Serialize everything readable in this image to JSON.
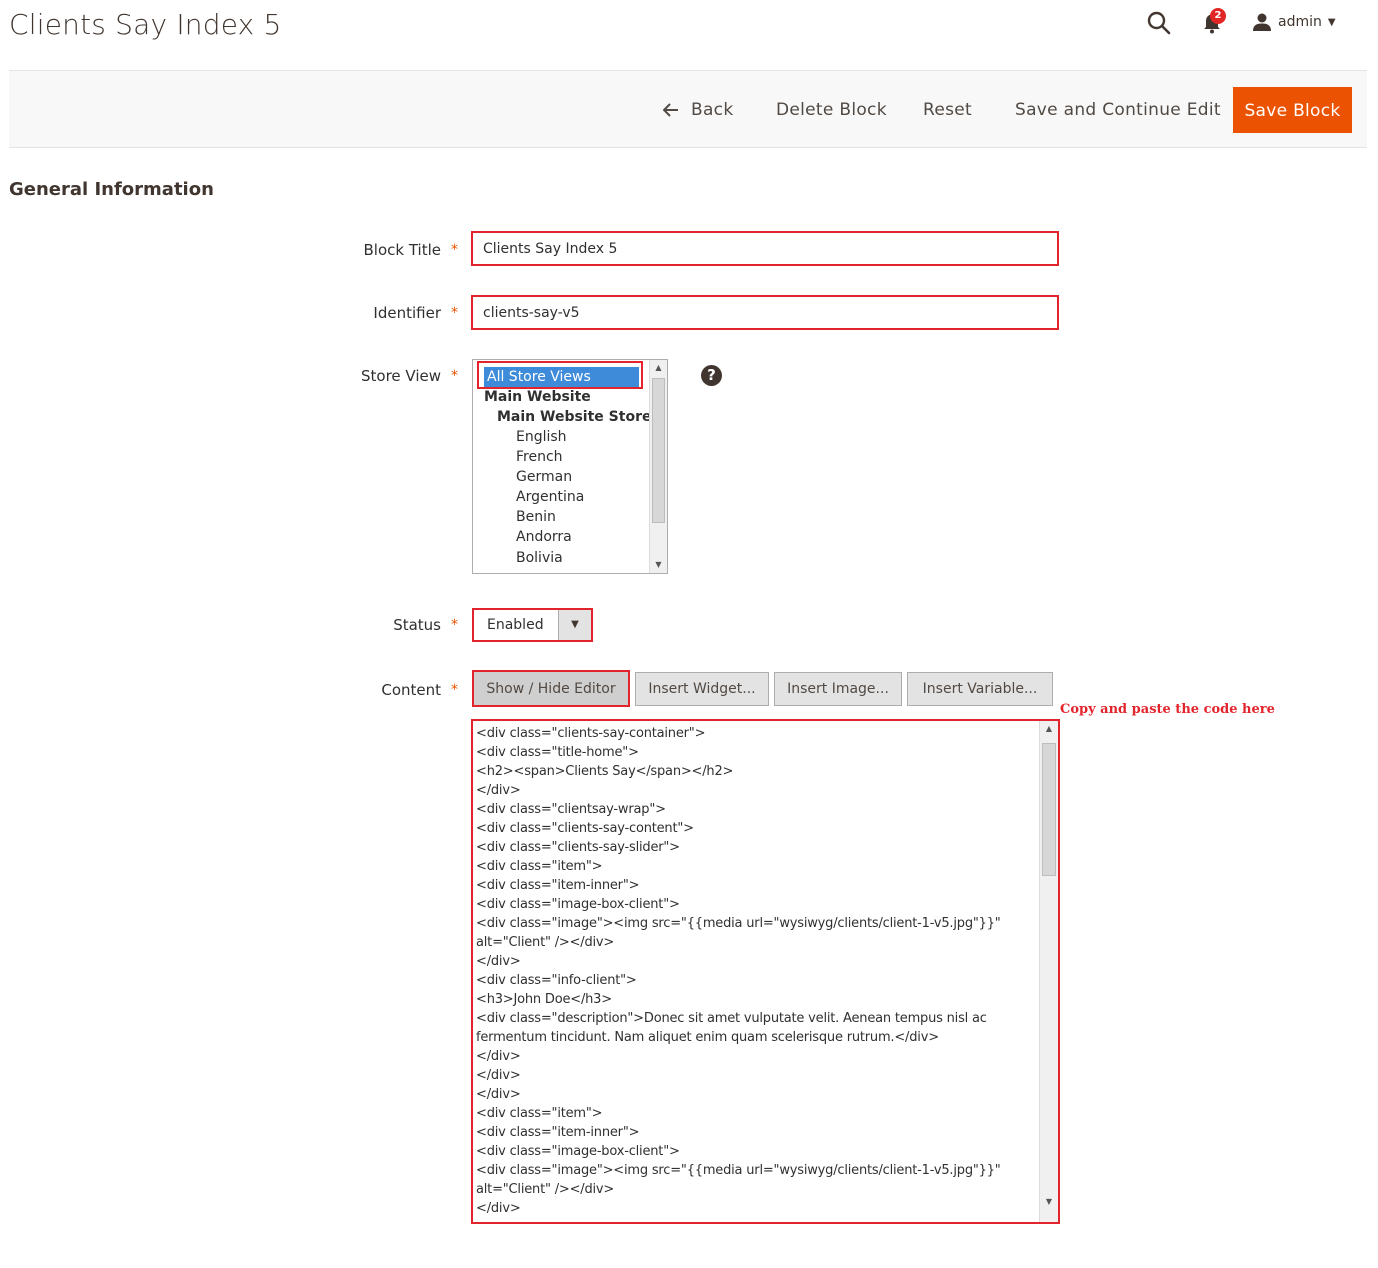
{
  "header": {
    "title": "Clients Say Index 5",
    "notification_count": "2",
    "user_name": "admin"
  },
  "actions": {
    "back": "Back",
    "delete": "Delete Block",
    "reset": "Reset",
    "save_continue": "Save and Continue Edit",
    "save": "Save Block"
  },
  "section": {
    "title": "General Information"
  },
  "form": {
    "block_title": {
      "label": "Block Title",
      "value": "Clients Say Index 5"
    },
    "identifier": {
      "label": "Identifier",
      "value": "clients-say-v5"
    },
    "store_view": {
      "label": "Store View",
      "options": [
        "All Store Views",
        "Main Website",
        "Main Website Store",
        "English",
        "French",
        "German",
        "Argentina",
        "Benin",
        "Andorra",
        "Bolivia"
      ],
      "selected": "All Store Views"
    },
    "status": {
      "label": "Status",
      "value": "Enabled"
    },
    "content": {
      "label": "Content",
      "buttons": {
        "show_hide": "Show / Hide Editor",
        "insert_widget": "Insert Widget...",
        "insert_image": "Insert Image...",
        "insert_variable": "Insert Variable..."
      },
      "annotation": "Copy and paste the code here",
      "code": "<div class=\"clients-say-container\">\n<div class=\"title-home\">\n<h2><span>Clients Say</span></h2>\n</div>\n<div class=\"clientsay-wrap\">\n<div class=\"clients-say-content\">\n<div class=\"clients-say-slider\">\n<div class=\"item\">\n<div class=\"item-inner\">\n<div class=\"image-box-client\">\n<div class=\"image\"><img src=\"{{media url=\"wysiwyg/clients/client-1-v5.jpg\"}}\"\nalt=\"Client\" /></div>\n</div>\n<div class=\"info-client\">\n<h3>John Doe</h3>\n<div class=\"description\">Donec sit amet vulputate velit. Aenean tempus nisl ac\nfermentum tincidunt. Nam aliquet enim quam scelerisque rutrum.</div>\n</div>\n</div>\n</div>\n<div class=\"item\">\n<div class=\"item-inner\">\n<div class=\"image-box-client\">\n<div class=\"image\"><img src=\"{{media url=\"wysiwyg/clients/client-1-v5.jpg\"}}\"\nalt=\"Client\" /></div>\n</div>"
    }
  }
}
